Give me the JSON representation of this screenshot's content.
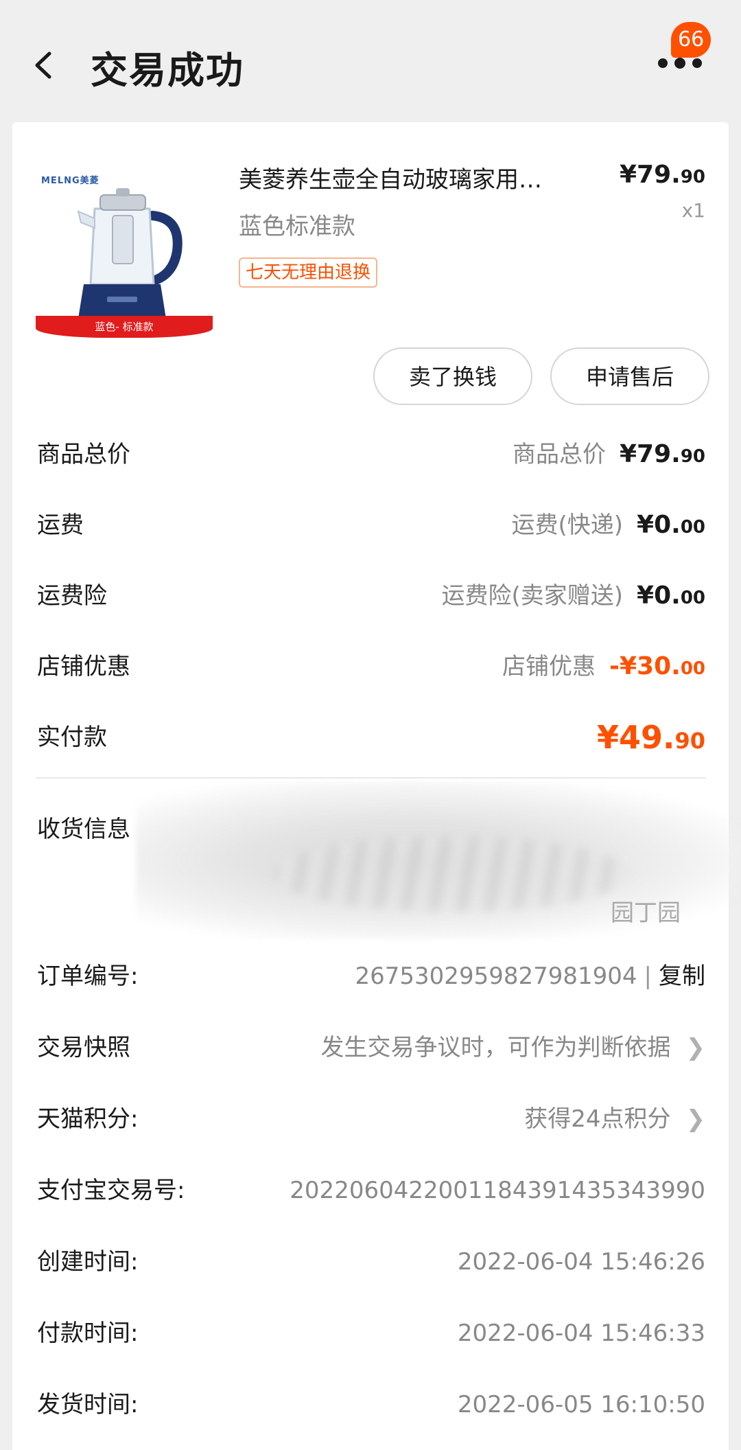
{
  "header": {
    "title": "交易成功",
    "badge_count": "66"
  },
  "product": {
    "brand": "MELNG美菱",
    "band_text": "蓝色- 标准款",
    "name": "美菱养生壶全自动玻璃家用…",
    "spec": "蓝色标准款",
    "tag": "七天无理由退换",
    "price_int": "¥79.",
    "price_dec": "90",
    "qty": "x1"
  },
  "actions": {
    "sell_label": "卖了换钱",
    "after_sale_label": "申请售后"
  },
  "summary": [
    {
      "label": "商品总价",
      "desc": "商品总价",
      "amt_int": "¥79.",
      "amt_dec": "90"
    },
    {
      "label": "运费",
      "desc": "运费(快递)",
      "amt_int": "¥0.",
      "amt_dec": "00"
    },
    {
      "label": "运费险",
      "desc": "运费险(卖家赠送)",
      "amt_int": "¥0.",
      "amt_dec": "00"
    },
    {
      "label": "店铺优惠",
      "desc": "店铺优惠",
      "amt_int": "-¥30.",
      "amt_dec": "00"
    },
    {
      "label": "实付款",
      "desc": "",
      "amt_int": "¥49.",
      "amt_dec": "90"
    }
  ],
  "address": {
    "label": "收货信息",
    "tail": "园丁园"
  },
  "order": {
    "id_label": "订单编号:",
    "id_value": "2675302959827981904",
    "copy_label": "复制",
    "snapshot_label": "交易快照",
    "snapshot_value": "发生交易争议时，可作为判断依据",
    "points_label": "天猫积分:",
    "points_value": "获得24点积分",
    "alipay_label": "支付宝交易号:",
    "alipay_value": "2022060422001184391435343990",
    "created_label": "创建时间:",
    "created_value": "2022-06-04  15:46:26",
    "paid_label": "付款时间:",
    "paid_value": "2022-06-04  15:46:33",
    "shipped_label": "发货时间:",
    "shipped_value": "2022-06-05  16:10:50"
  },
  "colors": {
    "accent": "#ff5000",
    "background": "#efefef"
  }
}
